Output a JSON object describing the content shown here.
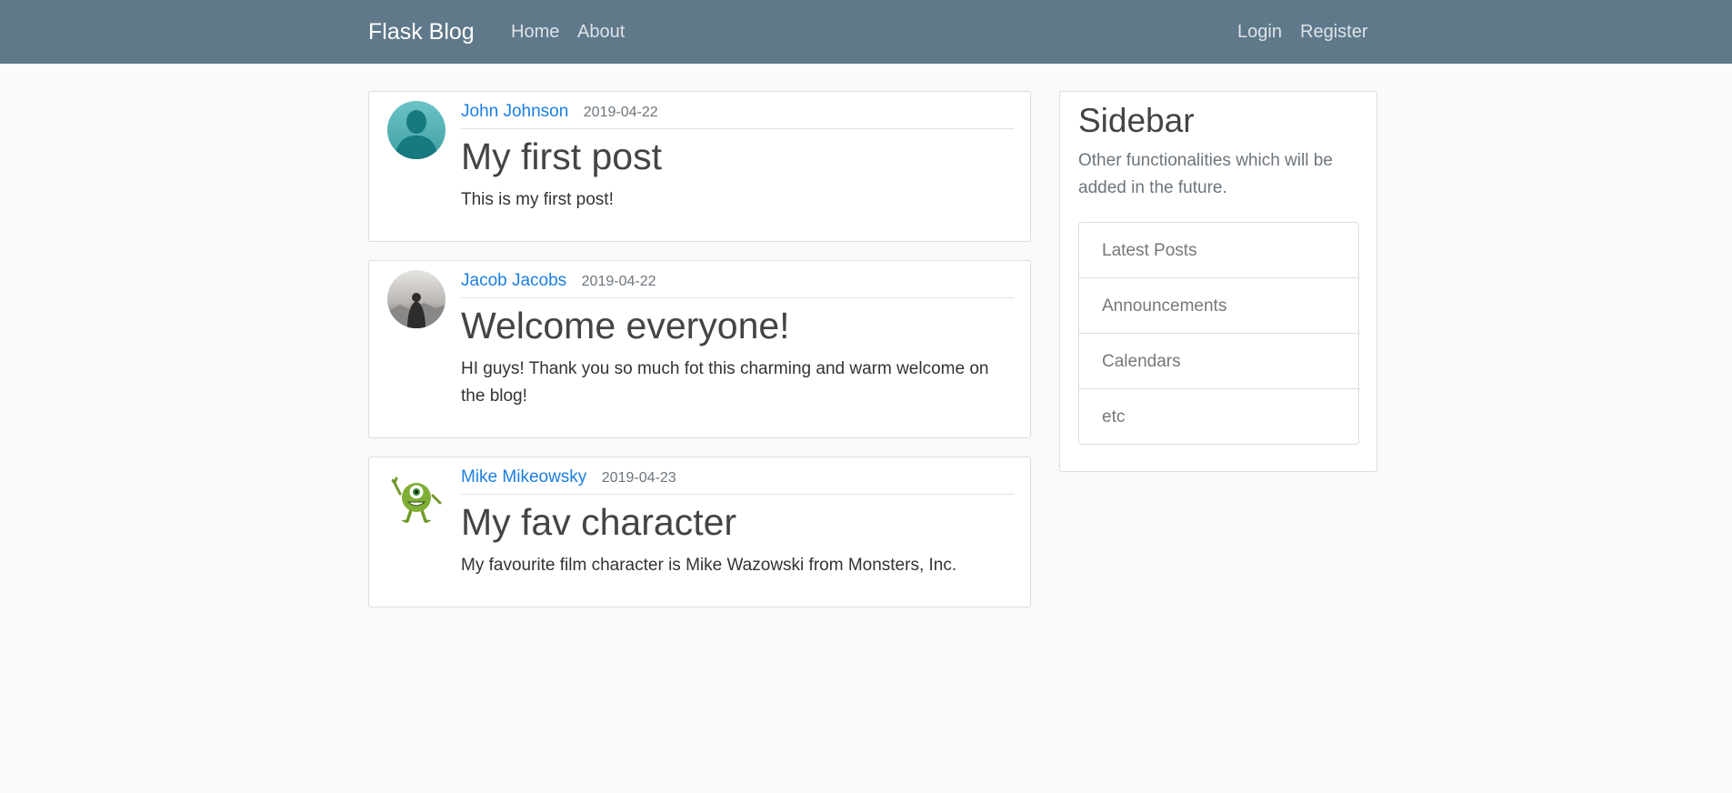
{
  "navbar": {
    "brand": "Flask Blog",
    "links_left": [
      "Home",
      "About"
    ],
    "links_right": [
      "Login",
      "Register"
    ]
  },
  "posts": [
    {
      "author": "John Johnson",
      "date": "2019-04-22",
      "title": "My first post",
      "content": "This is my first post!",
      "avatar": "default-silhouette-avatar"
    },
    {
      "author": "Jacob Jacobs",
      "date": "2019-04-22",
      "title": "Welcome everyone!",
      "content": "HI guys! Thank you so much fot this charming and warm welcome on the blog!",
      "avatar": "person-in-fog-avatar"
    },
    {
      "author": "Mike Mikeowsky",
      "date": "2019-04-23",
      "title": "My fav character",
      "content": "My favourite film character is Mike Wazowski from Monsters, Inc.",
      "avatar": "green-monster-avatar"
    }
  ],
  "sidebar": {
    "title": "Sidebar",
    "description": "Other functionalities which will be added in the future.",
    "items": [
      "Latest Posts",
      "Announcements",
      "Calendars",
      "etc"
    ]
  },
  "colors": {
    "navbar": "#5f788a",
    "link": "#1b7fe0",
    "background": "#fafafa"
  }
}
